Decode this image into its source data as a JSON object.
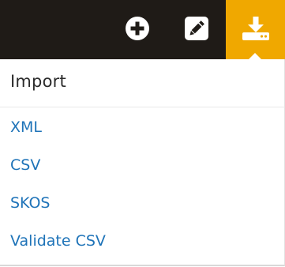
{
  "toolbar": {
    "buttons": [
      {
        "icon": "plus-circle-icon"
      },
      {
        "icon": "pencil-square-icon"
      },
      {
        "icon": "download-icon",
        "active_color": "#f0a800"
      }
    ],
    "background_color": "#1f1b17"
  },
  "import_menu": {
    "title": "Import",
    "items": [
      {
        "label": "XML"
      },
      {
        "label": "CSV"
      },
      {
        "label": "SKOS"
      },
      {
        "label": "Validate CSV"
      }
    ],
    "link_color": "#1e73b8"
  }
}
